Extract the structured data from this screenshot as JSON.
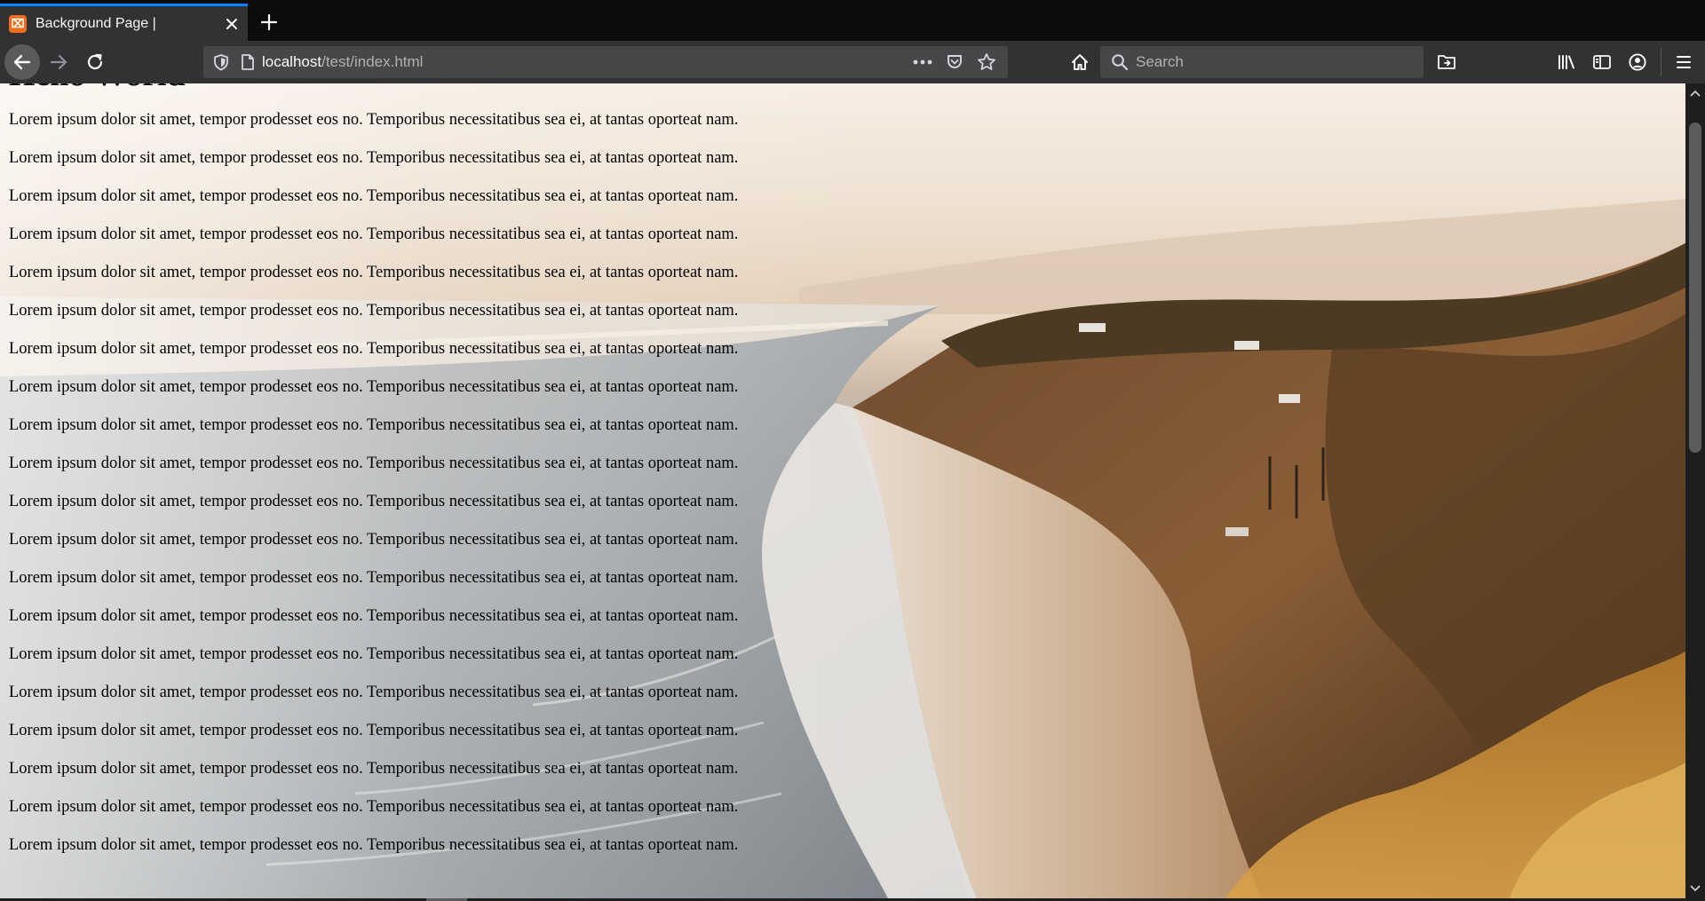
{
  "browser": {
    "tab": {
      "title": "Background Page |",
      "favicon": "xampp-icon"
    },
    "nav": {
      "back": "back-arrow-icon",
      "forward": "forward-arrow-icon",
      "reload": "reload-icon",
      "home": "home-icon"
    },
    "url": {
      "host": "localhost",
      "path": "/test/index.html"
    },
    "search": {
      "placeholder": "Search"
    },
    "colors": {
      "accent": "#0a84ff",
      "chrome": "#323234",
      "tabstrip": "#0c0c0d",
      "field": "#474749"
    }
  },
  "page": {
    "heading": "Hello World",
    "paragraphs": [
      "Lorem ipsum dolor sit amet, tempor prodesset eos no. Temporibus necessitatibus sea ei, at tantas oporteat nam.",
      "Lorem ipsum dolor sit amet, tempor prodesset eos no. Temporibus necessitatibus sea ei, at tantas oporteat nam.",
      "Lorem ipsum dolor sit amet, tempor prodesset eos no. Temporibus necessitatibus sea ei, at tantas oporteat nam.",
      "Lorem ipsum dolor sit amet, tempor prodesset eos no. Temporibus necessitatibus sea ei, at tantas oporteat nam.",
      "Lorem ipsum dolor sit amet, tempor prodesset eos no. Temporibus necessitatibus sea ei, at tantas oporteat nam.",
      "Lorem ipsum dolor sit amet, tempor prodesset eos no. Temporibus necessitatibus sea ei, at tantas oporteat nam.",
      "Lorem ipsum dolor sit amet, tempor prodesset eos no. Temporibus necessitatibus sea ei, at tantas oporteat nam.",
      "Lorem ipsum dolor sit amet, tempor prodesset eos no. Temporibus necessitatibus sea ei, at tantas oporteat nam.",
      "Lorem ipsum dolor sit amet, tempor prodesset eos no. Temporibus necessitatibus sea ei, at tantas oporteat nam.",
      "Lorem ipsum dolor sit amet, tempor prodesset eos no. Temporibus necessitatibus sea ei, at tantas oporteat nam.",
      "Lorem ipsum dolor sit amet, tempor prodesset eos no. Temporibus necessitatibus sea ei, at tantas oporteat nam.",
      "Lorem ipsum dolor sit amet, tempor prodesset eos no. Temporibus necessitatibus sea ei, at tantas oporteat nam.",
      "Lorem ipsum dolor sit amet, tempor prodesset eos no. Temporibus necessitatibus sea ei, at tantas oporteat nam.",
      "Lorem ipsum dolor sit amet, tempor prodesset eos no. Temporibus necessitatibus sea ei, at tantas oporteat nam.",
      "Lorem ipsum dolor sit amet, tempor prodesset eos no. Temporibus necessitatibus sea ei, at tantas oporteat nam.",
      "Lorem ipsum dolor sit amet, tempor prodesset eos no. Temporibus necessitatibus sea ei, at tantas oporteat nam.",
      "Lorem ipsum dolor sit amet, tempor prodesset eos no. Temporibus necessitatibus sea ei, at tantas oporteat nam.",
      "Lorem ipsum dolor sit amet, tempor prodesset eos no. Temporibus necessitatibus sea ei, at tantas oporteat nam.",
      "Lorem ipsum dolor sit amet, tempor prodesset eos no. Temporibus necessitatibus sea ei, at tantas oporteat nam.",
      "Lorem ipsum dolor sit amet, tempor prodesset eos no. Temporibus necessitatibus sea ei, at tantas oporteat nam."
    ],
    "background": "coastal-cliff-beach-photo"
  }
}
